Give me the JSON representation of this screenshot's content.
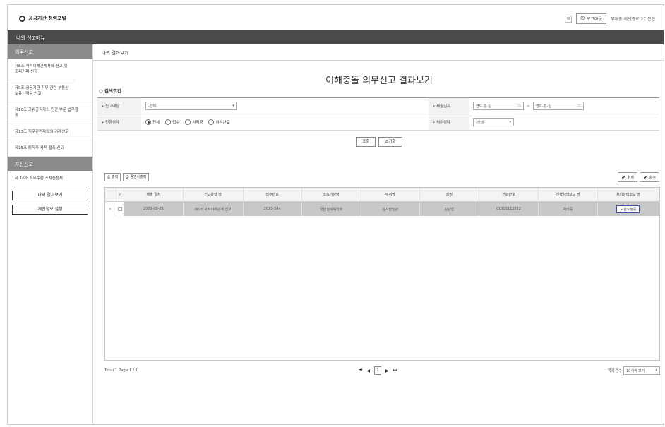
{
  "header": {
    "logo_text": "공공기관 청렴포털",
    "logout_label": "로그아웃",
    "session_text": "부재중 세션종료 27 분전"
  },
  "menubar": {
    "title": "나의 신고메뉴"
  },
  "sidebar": {
    "section1": "의무신고",
    "items": [
      "제8조 사적이해관계자의 신고 및 회피기피 신청",
      "제9조 공공기관 직무 관련 부동산 보유 · 매수 신고",
      "제10조 고위공직자의 민간 부문 업무활동",
      "제13조 직무관련자와의 거래신고",
      "제15조 퇴직자 사적 접촉 신고"
    ],
    "section2": "자진신고",
    "items2": [
      "제 16조 직무수행 조치신청서"
    ],
    "btn_results": "나의 결과보기",
    "btn_privacy": "개인정보 설정"
  },
  "main": {
    "breadcrumb": "나의 결과보기",
    "title": "이해충돌 의무신고 결과보기",
    "sub_head": "○ 검색조건"
  },
  "filter": {
    "label_target": "• 신고대상",
    "target_value": "-선택-",
    "label_date": "• 제출일자",
    "date_from": "연도-월-일",
    "date_to": "연도-월-일",
    "label_progress": "• 진행상태",
    "radio": [
      "전체",
      "접수",
      "처리중",
      "처리완료"
    ],
    "label_status": "• 처리상태",
    "status_value": "-선택-",
    "btn_search": "조회",
    "btn_reset": "초기화"
  },
  "toolbar": {
    "print": "출력",
    "doc_print": "증명서출력",
    "cancel": "취하",
    "recall": "회수"
  },
  "grid": {
    "headers": [
      "제출 일자",
      "신고유형 명",
      "접수번호",
      "소속기관명",
      "부서명",
      "성명",
      "전화번호",
      "진행상태코드 명",
      "처리상태코드 명"
    ],
    "row": [
      "2023-08-21",
      "제5조 사적이해관계 신고",
      "2023-584",
      "국민권익위원회",
      "감사담당관",
      "김남형",
      "01011112222",
      "처리중",
      "보완요청중"
    ]
  },
  "pager": {
    "total": "Total 1  Page 1 / 1",
    "page": "1",
    "size_label": "목록건수",
    "size_value": "10개씩 보기"
  }
}
